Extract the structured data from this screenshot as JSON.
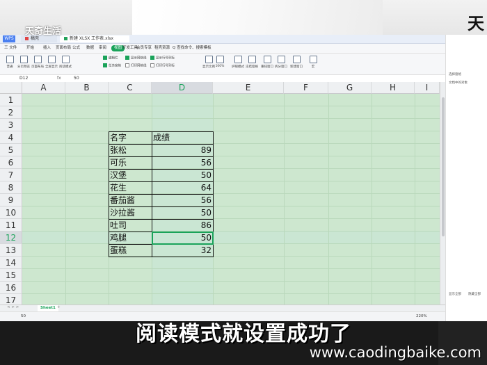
{
  "watermark": "天奇生活",
  "corner_char": "天",
  "subtitle": "阅读模式就设置成功了",
  "site": "www.caodingbaike.com",
  "tabs": [
    "WPS",
    "稿壳",
    "新建 XLSX 工作表.xlsx"
  ],
  "menu": [
    "三 文件",
    "开始",
    "插入",
    "页面布局",
    "公式",
    "数据",
    "审阅",
    "视图",
    "开发工具",
    "会员专享",
    "稻壳资源",
    "Q 查找命令、搜索模板"
  ],
  "active_menu": "视图",
  "ribbon": {
    "buttons": [
      "普通",
      "分页预览",
      "页面布局",
      "全屏显示",
      "阅读模式",
      "显示比例",
      "100%",
      "护眼模式",
      "冻结窗格",
      "重排窗口",
      "拆分窗口",
      "新建窗口",
      "宏"
    ],
    "checks": [
      {
        "label": "编辑栏",
        "checked": true
      },
      {
        "label": "显示网格线",
        "checked": true
      },
      {
        "label": "显示行号列标",
        "checked": true
      },
      {
        "label": "任务窗格",
        "checked": true
      },
      {
        "label": "打印网格线",
        "checked": false
      },
      {
        "label": "打印行号列标",
        "checked": false
      }
    ]
  },
  "formula_bar": {
    "name_box": "D12",
    "fx": "fx",
    "value": "50"
  },
  "columns": [
    {
      "label": "A",
      "selected": false
    },
    {
      "label": "B",
      "selected": false
    },
    {
      "label": "C",
      "selected": false
    },
    {
      "label": "D",
      "selected": true
    },
    {
      "label": "E",
      "selected": false
    },
    {
      "label": "F",
      "selected": false
    },
    {
      "label": "G",
      "selected": false
    },
    {
      "label": "H",
      "selected": false
    },
    {
      "label": "I",
      "selected": false
    }
  ],
  "rows": [
    "1",
    "2",
    "3",
    "4",
    "5",
    "6",
    "7",
    "8",
    "9",
    "10",
    "11",
    "12",
    "13",
    "14",
    "15",
    "16",
    "17"
  ],
  "selected_row": "12",
  "table": {
    "headers": [
      "名字",
      "成绩"
    ],
    "rows": [
      [
        "张松",
        "89"
      ],
      [
        "可乐",
        "56"
      ],
      [
        "汉堡",
        "50"
      ],
      [
        "花生",
        "64"
      ],
      [
        "番茄酱",
        "56"
      ],
      [
        "沙拉酱",
        "50"
      ],
      [
        "吐司",
        "86"
      ],
      [
        "鸡腿",
        "50"
      ],
      [
        "蛋糕",
        "32"
      ]
    ]
  },
  "sheet_tab": "Sheet1",
  "status": {
    "left": "50",
    "zoom": "220%"
  },
  "task_pane": {
    "title": "选择窗格",
    "subtitle": "文档中的对象",
    "footer": [
      "显示全部",
      "隐藏全部"
    ]
  },
  "colors": {
    "reading_mode_band": "#cde7cf",
    "accent": "#1aa35a"
  }
}
